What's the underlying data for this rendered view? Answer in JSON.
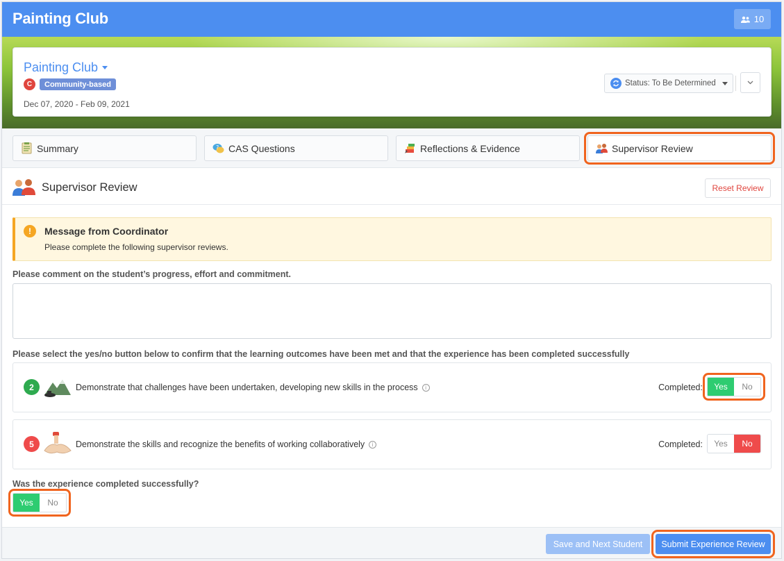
{
  "app": {
    "title": "Painting Club",
    "members_count": "10"
  },
  "header": {
    "experience_name": "Painting Club",
    "category_letter": "C",
    "category_tag": "Community-based",
    "dates": "Dec 07, 2020 - Feb 09, 2021",
    "status_label": "Status: To Be Determined"
  },
  "tabs": [
    {
      "label": "Summary",
      "icon": "checklist-icon"
    },
    {
      "label": "CAS Questions",
      "icon": "question-bubble-icon"
    },
    {
      "label": "Reflections & Evidence",
      "icon": "pencil-icon"
    },
    {
      "label": "Supervisor Review",
      "icon": "people-icon",
      "active": true
    }
  ],
  "section": {
    "title": "Supervisor Review",
    "reset_label": "Reset Review"
  },
  "alert": {
    "title": "Message from Coordinator",
    "message": "Please complete the following supervisor reviews.",
    "icon_glyph": "!"
  },
  "form": {
    "comment_prompt": "Please comment on the student’s progress, effort and commitment.",
    "comment_value": "",
    "outcomes_prompt": "Please select the yes/no button below to confirm that the learning outcomes have been met and that the experience has been completed successfully",
    "outcomes": [
      {
        "number": "2",
        "color": "#2eaa4f",
        "icon": "mountain-icon",
        "text": "Demonstrate that challenges have been undertaken, developing new skills in the process",
        "completed_label": "Completed:",
        "yes": "Yes",
        "no": "No",
        "selected": "yes"
      },
      {
        "number": "5",
        "color": "#ef4b4b",
        "icon": "hands-together-icon",
        "text": "Demonstrate the skills and recognize the benefits of working collaboratively",
        "completed_label": "Completed:",
        "yes": "Yes",
        "no": "No",
        "selected": "no"
      }
    ],
    "success_prompt": "Was the experience completed successfully?",
    "success_yes": "Yes",
    "success_no": "No",
    "success_selected": "yes"
  },
  "footer": {
    "save_label": "Save and Next Student",
    "submit_label": "Submit Experience Review"
  },
  "colors": {
    "primary": "#4c8ef0",
    "success": "#2ecc71",
    "danger": "#ef4b4b",
    "highlight": "#f0641e",
    "warning": "#f5a623"
  }
}
